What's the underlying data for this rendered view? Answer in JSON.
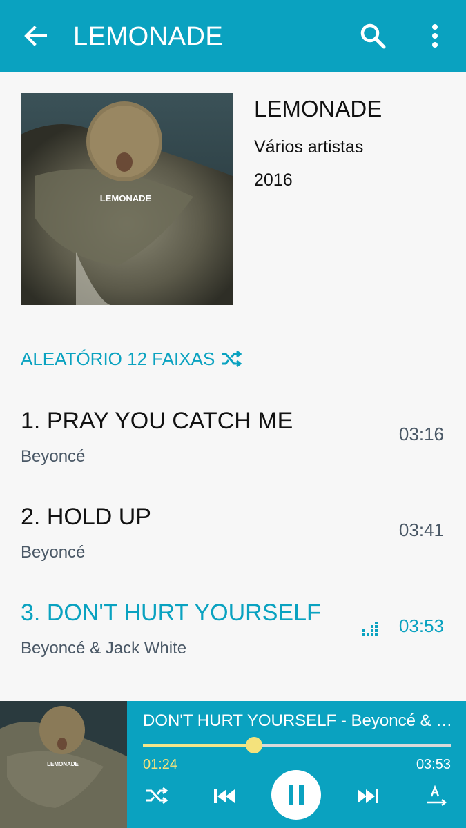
{
  "appbar": {
    "title": "LEMONADE",
    "back_icon": "arrow-left-icon",
    "search_icon": "search-icon",
    "more_icon": "more-vertical-icon"
  },
  "album": {
    "cover_text": "LEMONADE",
    "title": "LEMONADE",
    "artist": "Vários artistas",
    "year": "2016"
  },
  "shuffle": {
    "label": "ALEATÓRIO 12 FAIXAS",
    "icon": "shuffle-icon"
  },
  "tracks": [
    {
      "number": "1.",
      "title": "PRAY YOU CATCH ME",
      "artist": "Beyoncé",
      "duration": "03:16",
      "playing": false
    },
    {
      "number": "2.",
      "title": "HOLD UP",
      "artist": "Beyoncé",
      "duration": "03:41",
      "playing": false
    },
    {
      "number": "3.",
      "title": "DON'T HURT YOURSELF",
      "artist": "Beyoncé & Jack White",
      "duration": "03:53",
      "playing": true
    }
  ],
  "player": {
    "now_playing": "DON'T HURT YOURSELF - Beyoncé & Jack White",
    "cover_text": "LEMONADE",
    "elapsed": "01:24",
    "total": "03:53",
    "progress": 0.36
  },
  "colors": {
    "accent": "#0aa2c0",
    "progress_knob": "#f4e27c"
  }
}
